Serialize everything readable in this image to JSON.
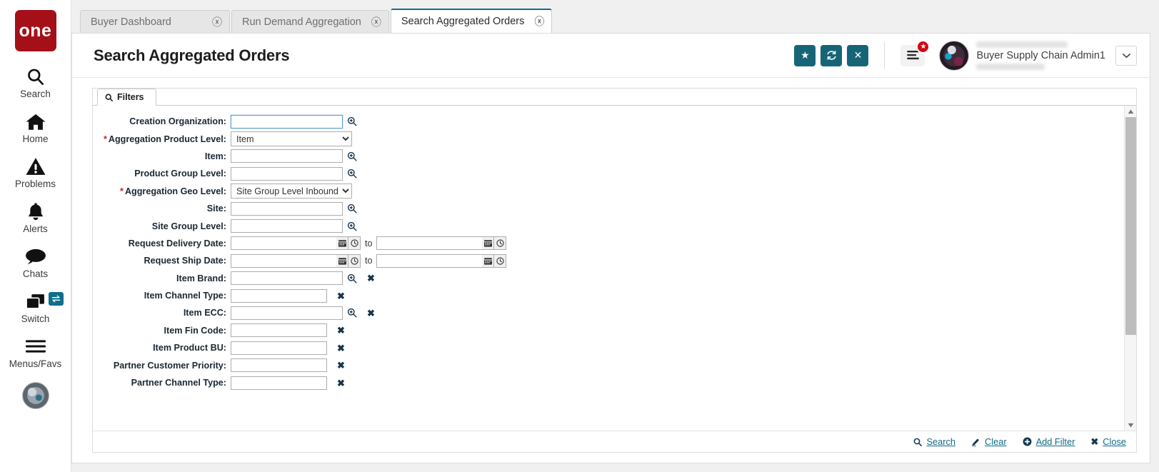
{
  "brand": {
    "logo_text": "one",
    "logo_color": "#a50f17"
  },
  "accent": {
    "teal": "#166577",
    "link": "#0f6a8b",
    "required": "#c0272d",
    "badge_red": "#d40511"
  },
  "rail": {
    "items": [
      {
        "label": "Search",
        "icon": "search-icon"
      },
      {
        "label": "Home",
        "icon": "home-icon"
      },
      {
        "label": "Problems",
        "icon": "warning-triangle-icon"
      },
      {
        "label": "Alerts",
        "icon": "bell-icon"
      },
      {
        "label": "Chats",
        "icon": "chat-bubble-icon"
      },
      {
        "label": "Switch",
        "icon": "windows-stack-icon",
        "badge_icon": "swap-arrows-icon"
      },
      {
        "label": "Menus/Favs",
        "icon": "hamburger-icon"
      }
    ]
  },
  "tabs": [
    {
      "label": "Buyer Dashboard",
      "active": false,
      "close_icon": "close-circle-icon"
    },
    {
      "label": "Run Demand Aggregation",
      "active": false,
      "close_icon": "close-circle-icon"
    },
    {
      "label": "Search Aggregated Orders",
      "active": true,
      "close_icon": "close-circle-icon"
    }
  ],
  "header": {
    "title": "Search Aggregated Orders",
    "buttons": [
      {
        "name": "favorite-button",
        "icon": "star-icon",
        "glyph": "★"
      },
      {
        "name": "refresh-button",
        "icon": "refresh-icon",
        "glyph": "↻"
      },
      {
        "name": "close-page-button",
        "icon": "close-icon",
        "glyph": "✕"
      }
    ],
    "menu_button": {
      "icon": "hamburger-menu-icon",
      "badge_icon": "star-badge-icon",
      "badge_glyph": "★"
    },
    "user": {
      "name": "Buyer Supply Chain Admin1",
      "avatar_icon": "user-avatar",
      "dropdown_icon": "chevron-down-icon"
    }
  },
  "filters_panel": {
    "tab_label": "Filters",
    "tab_icon": "search-icon",
    "rows": [
      {
        "label": "Creation Organization",
        "required": false,
        "type": "lookup",
        "value": "",
        "focused": true,
        "width": "lg",
        "has_clear": false
      },
      {
        "label": "Aggregation Product Level",
        "required": true,
        "type": "select",
        "value": "Item",
        "options": [
          "Item"
        ],
        "has_clear": false
      },
      {
        "label": "Item",
        "required": false,
        "type": "lookup",
        "value": "",
        "width": "lg",
        "has_clear": false
      },
      {
        "label": "Product Group Level",
        "required": false,
        "type": "lookup",
        "value": "",
        "width": "lg",
        "has_clear": false
      },
      {
        "label": "Aggregation Geo Level",
        "required": true,
        "type": "select",
        "value": "Site Group Level Inbound",
        "options": [
          "Site Group Level Inbound"
        ],
        "has_clear": false
      },
      {
        "label": "Site",
        "required": false,
        "type": "lookup",
        "value": "",
        "width": "lg",
        "has_clear": false
      },
      {
        "label": "Site Group Level",
        "required": false,
        "type": "lookup",
        "value": "",
        "width": "lg",
        "has_clear": false
      },
      {
        "label": "Request Delivery Date",
        "required": false,
        "type": "daterange",
        "value_from": "",
        "value_to": "",
        "separator": "to",
        "has_clear": false
      },
      {
        "label": "Request Ship Date",
        "required": false,
        "type": "daterange",
        "value_from": "",
        "value_to": "",
        "separator": "to",
        "has_clear": false
      },
      {
        "label": "Item Brand",
        "required": false,
        "type": "lookup",
        "value": "",
        "width": "lg",
        "has_clear": true
      },
      {
        "label": "Item Channel Type",
        "required": false,
        "type": "text",
        "value": "",
        "width": "md",
        "has_clear": true
      },
      {
        "label": "Item ECC",
        "required": false,
        "type": "lookup",
        "value": "",
        "width": "lg",
        "has_clear": true
      },
      {
        "label": "Item Fin Code",
        "required": false,
        "type": "text",
        "value": "",
        "width": "md",
        "has_clear": true
      },
      {
        "label": "Item Product BU",
        "required": false,
        "type": "text",
        "value": "",
        "width": "md",
        "has_clear": true
      },
      {
        "label": "Partner Customer Priority",
        "required": false,
        "type": "text",
        "value": "",
        "width": "md",
        "has_clear": true
      },
      {
        "label": "Partner Channel Type",
        "required": false,
        "type": "text",
        "value": "",
        "width": "md",
        "has_clear": true
      }
    ],
    "scrollbar": {
      "up_icon": "scroll-up-arrow",
      "down_icon": "scroll-down-arrow",
      "thumb_position_pct": 0,
      "thumb_size_pct": 72
    },
    "footer_links": [
      {
        "label": "Search",
        "icon": "search-icon"
      },
      {
        "label": "Clear",
        "icon": "eraser-icon"
      },
      {
        "label": "Add Filter",
        "icon": "plus-circle-icon"
      },
      {
        "label": "Close",
        "icon": "close-x-icon"
      }
    ]
  }
}
